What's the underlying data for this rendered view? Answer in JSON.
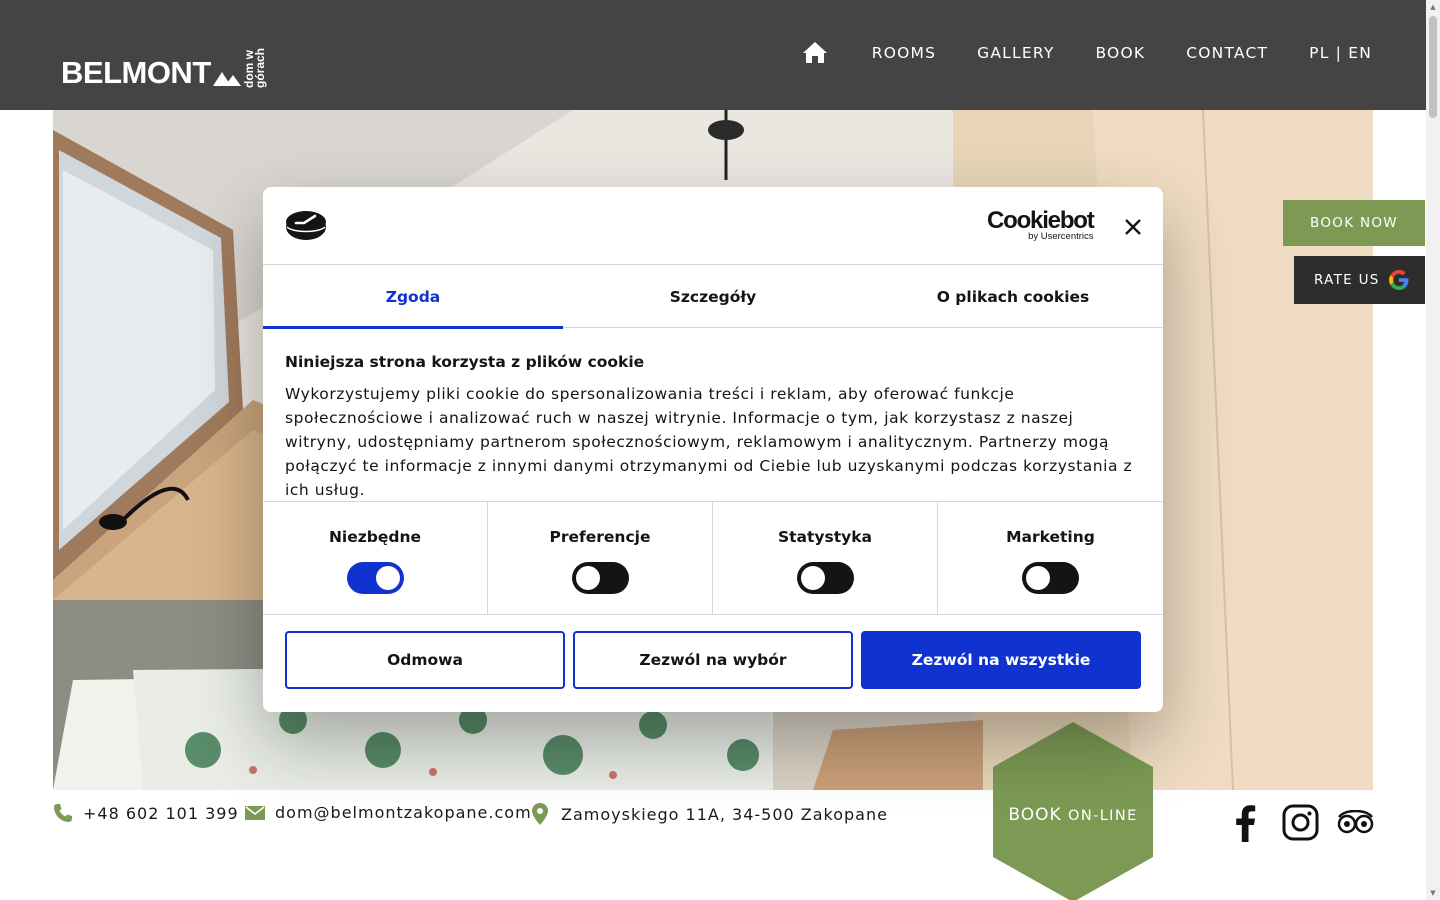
{
  "header": {
    "logo_text": "BELMONT",
    "logo_sub": "dom w górach",
    "nav": [
      "ROOMS",
      "GALLERY",
      "BOOK",
      "CONTACT",
      "PL | EN"
    ]
  },
  "side": {
    "book_now": "BOOK NOW",
    "rate_us": "RATE US"
  },
  "cookie": {
    "brand": "Cookiebot",
    "brand_by": "by Usercentrics",
    "tabs": [
      "Zgoda",
      "Szczegóły",
      "O plikach cookies"
    ],
    "active_tab": "Zgoda",
    "title": "Niniejsza strona korzysta z plików cookie",
    "body": "Wykorzystujemy pliki cookie do spersonalizowania treści i reklam, aby oferować funkcje społecznościowe i analizować ruch w naszej witrynie. Informacje o tym, jak korzystasz z naszej witryny, udostępniamy partnerom społecznościowym, reklamowym i analitycznym. Partnerzy mogą połączyć te informacje z innymi danymi otrzymanymi od Ciebie lub uzyskanymi podczas korzystania z ich usług.",
    "categories": [
      {
        "label": "Niezbędne",
        "enabled": true
      },
      {
        "label": "Preferencje",
        "enabled": false
      },
      {
        "label": "Statystyka",
        "enabled": false
      },
      {
        "label": "Marketing",
        "enabled": false
      }
    ],
    "buttons": {
      "deny": "Odmowa",
      "allow_selection": "Zezwól na wybór",
      "allow_all": "Zezwól na wszystkie"
    }
  },
  "contact": {
    "phone": "+48 602 101 399",
    "email": "dom@belmontzakopane.com",
    "address": "Zamoyskiego 11A, 34-500 Zakopane"
  },
  "book_online": {
    "bold": "BOOK",
    "thin": "ON-LINE"
  },
  "colors": {
    "header_bg": "#444444",
    "accent_green": "#7c9a54",
    "cookie_blue": "#1032cf"
  }
}
